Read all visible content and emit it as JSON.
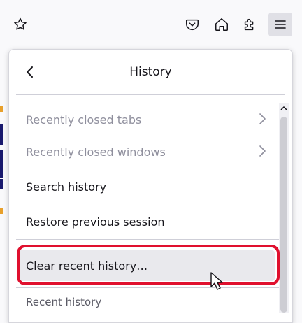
{
  "toolbar": {
    "icons": [
      "bookmark-star-icon",
      "pocket-icon",
      "home-icon",
      "extensions-icon",
      "app-menu-icon"
    ]
  },
  "panel": {
    "title": "History",
    "items": [
      {
        "label": "Recently closed tabs",
        "disabled": true,
        "has_submenu": true
      },
      {
        "label": "Recently closed windows",
        "disabled": true,
        "has_submenu": true
      },
      {
        "label": "Search history",
        "disabled": false,
        "has_submenu": false
      },
      {
        "label": "Restore previous session",
        "disabled": false,
        "has_submenu": false
      },
      {
        "label": "Clear recent history…",
        "disabled": false,
        "has_submenu": false,
        "hovered": true
      }
    ],
    "section_label": "Recent history"
  },
  "colors": {
    "highlight": "#e0102e",
    "disabled_text": "#8f8f9d",
    "hover_bg": "#e9e9ed"
  }
}
